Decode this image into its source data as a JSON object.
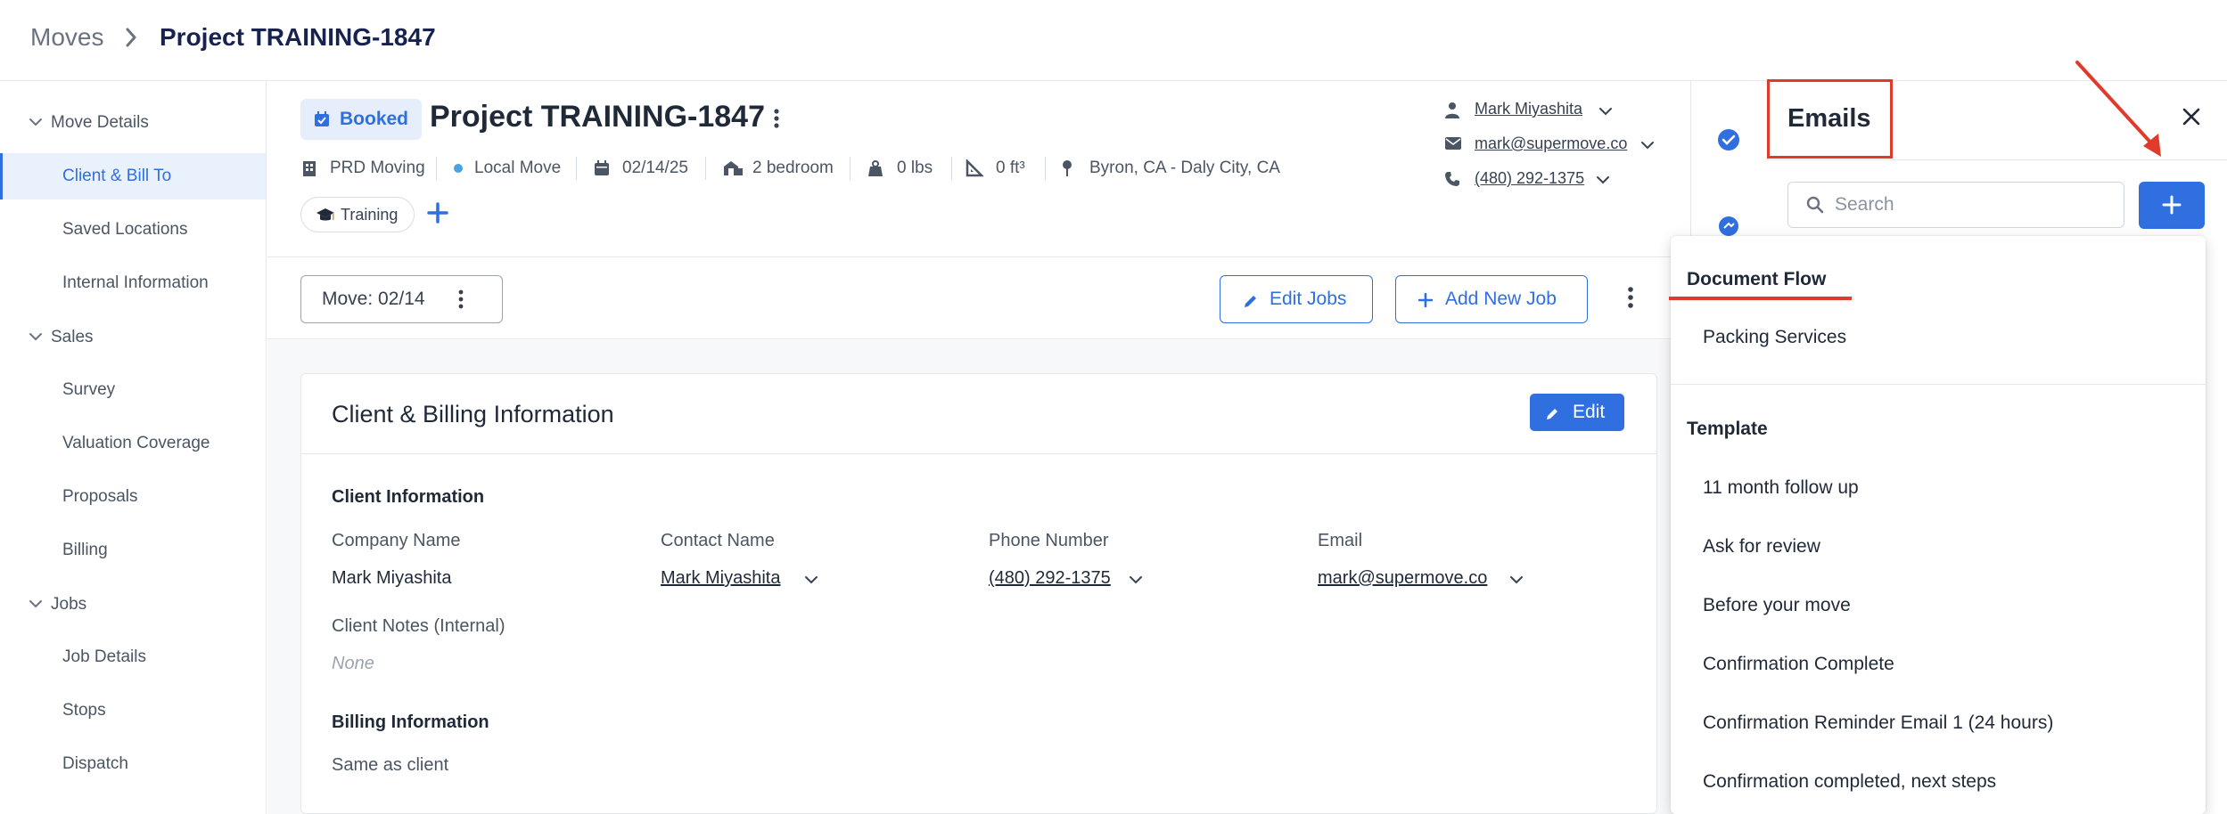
{
  "breadcrumb": {
    "root": "Moves",
    "current": "Project TRAINING-1847"
  },
  "sidebar": {
    "sections": [
      {
        "label": "Move Details",
        "items": [
          "Client & Bill To",
          "Saved Locations",
          "Internal Information"
        ]
      },
      {
        "label": "Sales",
        "items": [
          "Survey",
          "Valuation Coverage",
          "Proposals",
          "Billing"
        ]
      },
      {
        "label": "Jobs",
        "items": [
          "Job Details",
          "Stops",
          "Dispatch"
        ]
      }
    ],
    "active_item": "Client & Bill To"
  },
  "project": {
    "status": "Booked",
    "title": "Project TRAINING-1847",
    "meta": {
      "company": "PRD Moving",
      "move_type": "Local Move",
      "date": "02/14/25",
      "size": "2 bedroom",
      "weight": "0 lbs",
      "volume": "0 ft³",
      "route": "Byron, CA - Daly City, CA"
    },
    "tag": "Training",
    "contact": {
      "name": "Mark Miyashita",
      "email": "mark@supermove.co",
      "phone": "(480) 292-1375"
    }
  },
  "jobbar": {
    "move_select": "Move: 02/14",
    "edit_jobs": "Edit Jobs",
    "add_new_job": "Add New Job"
  },
  "card": {
    "title": "Client & Billing Information",
    "edit_label": "Edit",
    "client_info": {
      "heading": "Client Information",
      "company_name_label": "Company Name",
      "company_name": "Mark Miyashita",
      "contact_name_label": "Contact Name",
      "contact_name": "Mark Miyashita",
      "phone_label": "Phone Number",
      "phone": "(480) 292-1375",
      "email_label": "Email",
      "email": "mark@supermove.co",
      "notes_label": "Client Notes (Internal)",
      "notes": "None"
    },
    "billing_info": {
      "heading": "Billing Information",
      "value": "Same as client"
    }
  },
  "emails_panel": {
    "title": "Emails",
    "search_placeholder": "Search",
    "dropdown": {
      "document_flow_heading": "Document Flow",
      "document_flow_items": [
        "Packing Services"
      ],
      "template_heading": "Template",
      "template_items": [
        "11 month follow up",
        "Ask for review",
        "Before your move",
        "Confirmation Complete",
        "Confirmation Reminder Email 1 (24 hours)",
        "Confirmation completed, next steps"
      ]
    }
  },
  "colors": {
    "accent": "#2f6fe0",
    "title_navy": "#17224e",
    "annotation_red": "#e03a2b",
    "active_bg": "#e9f1fc"
  }
}
